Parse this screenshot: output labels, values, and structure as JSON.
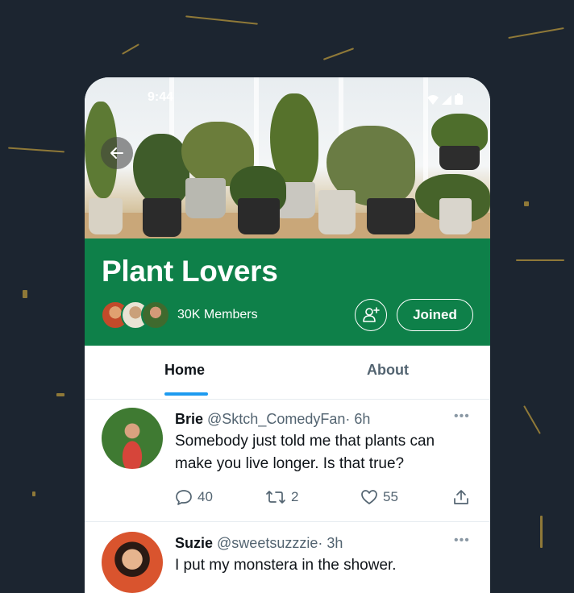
{
  "status_bar": {
    "time": "9:44"
  },
  "community": {
    "title": "Plant Lovers",
    "members_label": "30K Members",
    "joined_label": "Joined"
  },
  "tabs": [
    {
      "label": "Home",
      "active": true
    },
    {
      "label": "About",
      "active": false
    }
  ],
  "tweets": [
    {
      "name": "Brie",
      "handle": "@Sktch_ComedyFan",
      "time": "· 6h",
      "text": "Somebody just told me that plants can make you live longer. Is that true?",
      "replies": "40",
      "retweets": "2",
      "likes": "55"
    },
    {
      "name": "Suzie",
      "handle": "@sweetsuzzzie",
      "time": "· 3h",
      "text": "I put my monstera in the shower."
    }
  ],
  "colors": {
    "background": "#1c2530",
    "banner": "#0e8049",
    "accent": "#1d9bf0",
    "muted_text": "#536471"
  },
  "icons": [
    "back-arrow-icon",
    "signal-icon",
    "battery-icon",
    "add-member-icon",
    "reply-icon",
    "retweet-icon",
    "like-icon",
    "share-icon",
    "more-icon"
  ]
}
